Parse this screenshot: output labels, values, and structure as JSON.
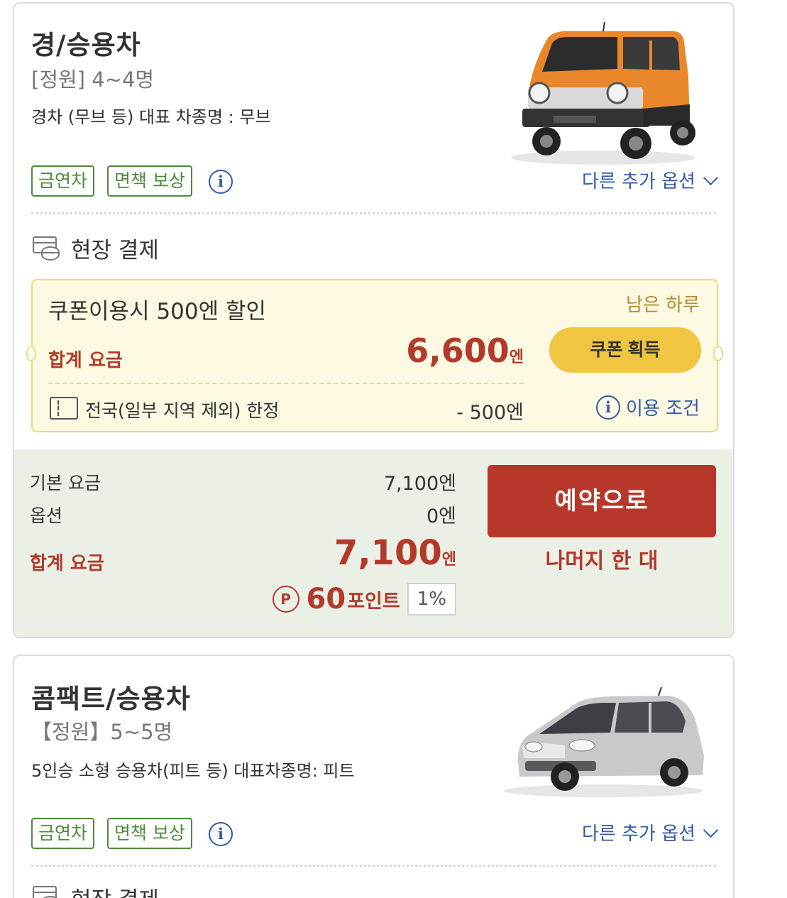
{
  "cards": [
    {
      "title": "경/승용차",
      "capacity": "[정원] 4~4명",
      "description": "경차 (무브 등) 대표 차종명 : 무브",
      "tags": [
        "금연차",
        "면책 보상"
      ],
      "more_options": "다른 추가 옵션",
      "payment_method": "현장 결제",
      "car_image": "orange-suv-car",
      "coupon": {
        "title": "쿠폰이용시 500엔 할인",
        "days_left": "남은 하루",
        "total_label": "합계 요금",
        "price_number": "6,600",
        "price_unit": "엔",
        "button": "쿠폰 획득",
        "region": "전국(일부 지역 제외) 한정",
        "discount": "- 500엔",
        "terms": "이용 조건"
      },
      "summary": {
        "base_label": "기본 요금",
        "base_value": "7,100엔",
        "option_label": "옵션",
        "option_value": "0엔",
        "total_label": "합계 요금",
        "total_number": "7,100",
        "total_unit": "엔",
        "points_icon": "P",
        "points_number": "60",
        "points_unit": "포인트",
        "points_rate": "1%",
        "reserve_button": "예약으로",
        "remaining": "나머지 한 대"
      }
    },
    {
      "title": "콤팩트/승용차",
      "capacity": "【정원】5~5명",
      "description": "5인승 소형 승용차(피트 등) 대표차종명: 피트",
      "tags": [
        "금연차",
        "면책 보상"
      ],
      "more_options": "다른 추가 옵션",
      "payment_method": "현장 결제",
      "car_image": "silver-hatchback-car"
    }
  ],
  "colors": {
    "accent_red": "#b33a2a",
    "reserve_button": "#b7382b",
    "coupon_button": "#f0c53f",
    "tag_green": "#4f8a3c",
    "link_blue": "#2f5aa8",
    "coupon_bg": "#fdf9e3",
    "summary_bg": "#eaf0e6"
  }
}
